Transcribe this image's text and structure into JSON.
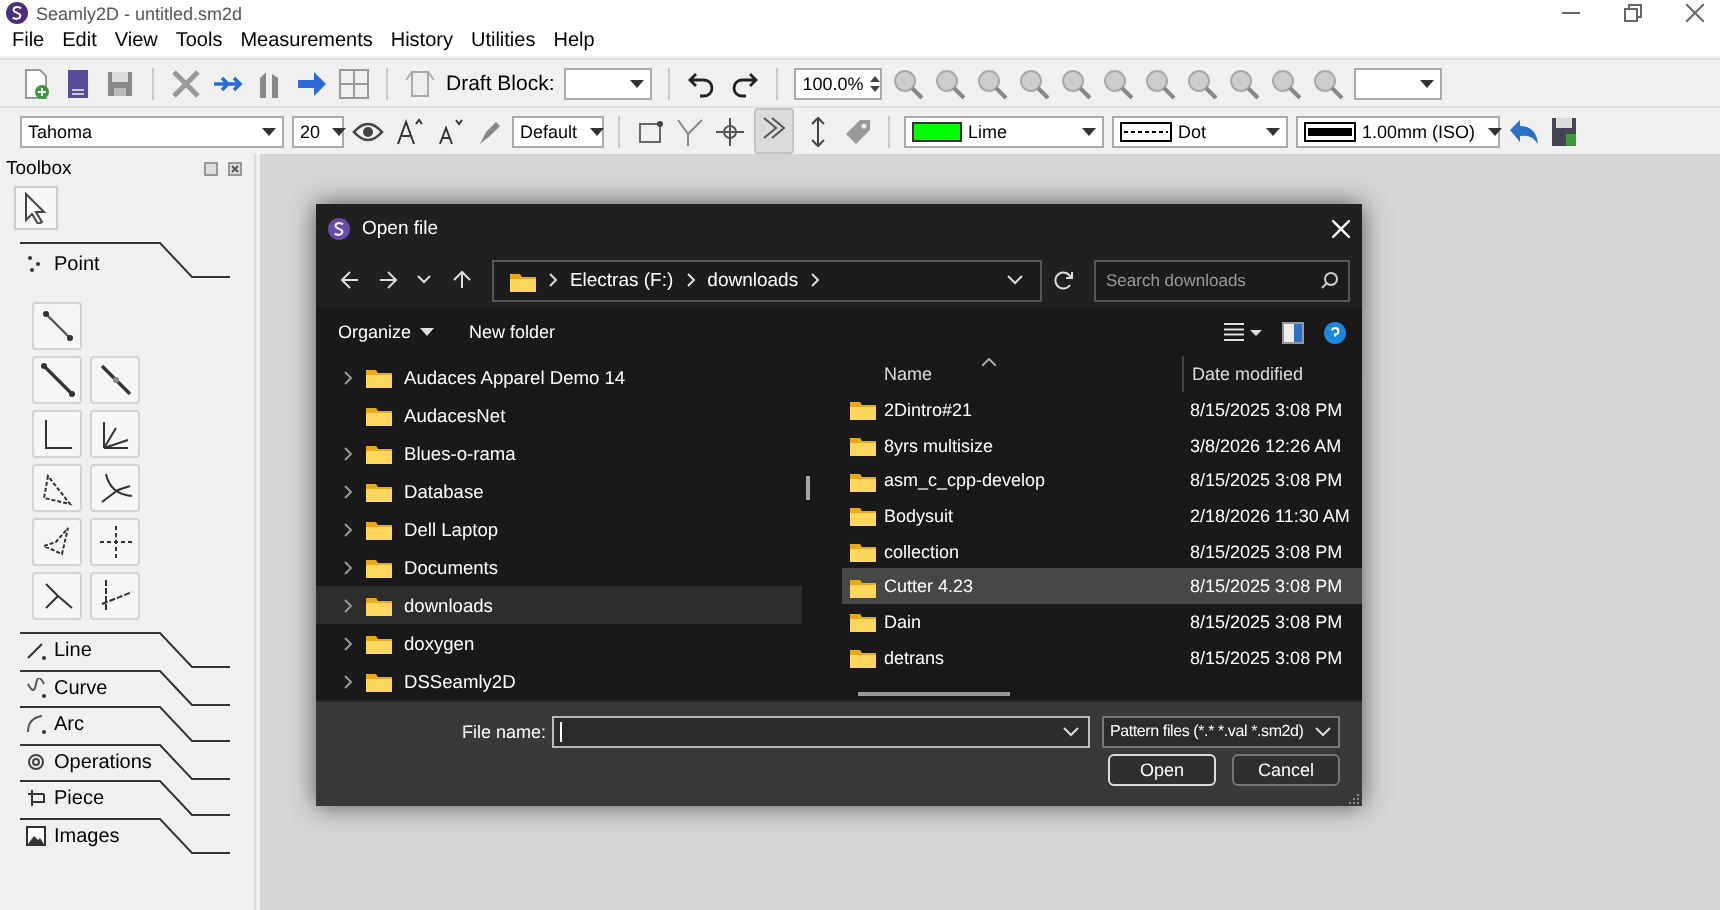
{
  "app": {
    "title": "Seamly2D - untitled.sm2d"
  },
  "menu": [
    "File",
    "Edit",
    "View",
    "Tools",
    "Measurements",
    "History",
    "Utilities",
    "Help"
  ],
  "toolbar": {
    "draft_block_label": "Draft Block:",
    "zoom": "100.0%"
  },
  "format_bar": {
    "font": "Tahoma",
    "size": "20",
    "style": "Default",
    "line_color": {
      "label": "Lime",
      "color": "#00ff00"
    },
    "line_type": "Dot",
    "line_weight": "1.00mm (ISO)"
  },
  "toolbox": {
    "title": "Toolbox",
    "sections": [
      {
        "label": "Point",
        "expanded": true
      },
      {
        "label": "Line",
        "expanded": false
      },
      {
        "label": "Curve",
        "expanded": false
      },
      {
        "label": "Arc",
        "expanded": false
      },
      {
        "label": "Operations",
        "expanded": false
      },
      {
        "label": "Piece",
        "expanded": false
      },
      {
        "label": "Images",
        "expanded": false
      }
    ]
  },
  "dialog": {
    "title": "Open file",
    "path": [
      "Electras (F:)",
      "downloads"
    ],
    "search": {
      "placeholder": "Search downloads"
    },
    "commands": [
      {
        "label": "Organize",
        "dropdown": true
      },
      {
        "label": "New folder",
        "dropdown": false
      }
    ],
    "tree": [
      {
        "label": "Audaces Apparel Demo 14",
        "expandable": true,
        "selected": false
      },
      {
        "label": "AudacesNet",
        "expandable": false,
        "selected": false
      },
      {
        "label": "Blues-o-rama",
        "expandable": true,
        "selected": false
      },
      {
        "label": "Database",
        "expandable": true,
        "selected": false
      },
      {
        "label": "Dell Laptop",
        "expandable": true,
        "selected": false
      },
      {
        "label": "Documents",
        "expandable": true,
        "selected": false
      },
      {
        "label": "downloads",
        "expandable": true,
        "selected": true
      },
      {
        "label": "doxygen",
        "expandable": true,
        "selected": false
      },
      {
        "label": "DSSeamly2D",
        "expandable": true,
        "selected": false
      }
    ],
    "columns": [
      "Name",
      "Date modified"
    ],
    "files": [
      {
        "name": "2Dintro#21",
        "date": "8/15/2025 3:08 PM",
        "selected": false
      },
      {
        "name": "8yrs multisize",
        "date": "3/8/2026 12:26 AM",
        "selected": false
      },
      {
        "name": "asm_c_cpp-develop",
        "date": "8/15/2025 3:08 PM",
        "selected": false
      },
      {
        "name": "Bodysuit",
        "date": "2/18/2026 11:30 AM",
        "selected": false
      },
      {
        "name": "collection",
        "date": "8/15/2025 3:08 PM",
        "selected": false
      },
      {
        "name": "Cutter 4.23",
        "date": "8/15/2025 3:08 PM",
        "selected": true
      },
      {
        "name": "Dain",
        "date": "8/15/2025 3:08 PM",
        "selected": false
      },
      {
        "name": "detrans",
        "date": "8/15/2025 3:08 PM",
        "selected": false
      }
    ],
    "file_name": {
      "label": "File name:"
    },
    "filter": "Pattern files (*.* *.val *.sm2d)",
    "buttons": [
      "Open",
      "Cancel"
    ]
  }
}
